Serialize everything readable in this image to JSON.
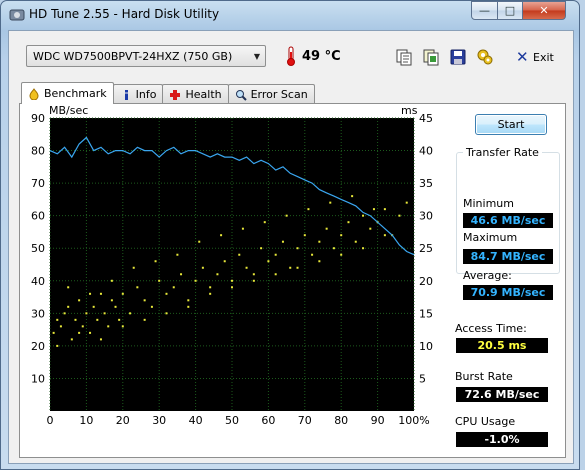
{
  "window": {
    "title": "HD Tune 2.55 - Hard Disk Utility",
    "min_glyph": "—",
    "max_glyph": "□",
    "close_glyph": "✕"
  },
  "toolbar": {
    "drive": "WDC WD7500BPVT-24HXZ (750 GB)",
    "temperature": "49 °C",
    "exit_label": "Exit",
    "icons": [
      "copy-text-icon",
      "copy-info-icon",
      "save-icon",
      "options-icon",
      "exit-icon"
    ]
  },
  "tabs": [
    {
      "label": "Benchmark",
      "icon": "benchmark-icon",
      "active": true
    },
    {
      "label": "Info",
      "icon": "info-icon",
      "active": false
    },
    {
      "label": "Health",
      "icon": "health-icon",
      "active": false
    },
    {
      "label": "Error Scan",
      "icon": "error-scan-icon",
      "active": false
    }
  ],
  "benchmark": {
    "start_label": "Start",
    "transfer_rate_title": "Transfer Rate",
    "minimum_label": "Minimum",
    "minimum_value": "46.6 MB/sec",
    "maximum_label": "Maximum",
    "maximum_value": "84.7 MB/sec",
    "average_label": "Average:",
    "average_value": "70.9 MB/sec",
    "access_time_label": "Access Time:",
    "access_time_value": "20.5 ms",
    "burst_rate_label": "Burst Rate",
    "burst_rate_value": "72.6 MB/sec",
    "cpu_usage_label": "CPU Usage",
    "cpu_usage_value": "-1.0%"
  },
  "colors": {
    "transfer_line": "#3aa6f0",
    "access_dots": "#e8e83a",
    "grid": "#1c5a1c",
    "plot_bg": "#000000"
  },
  "chart_data": {
    "type": "line",
    "ylabel": "MB/sec",
    "y2label": "ms",
    "ylim": [
      0,
      90
    ],
    "y2lim": [
      0,
      45
    ],
    "xlim": [
      0,
      100
    ],
    "x_ticks": [
      "0",
      "10",
      "20",
      "30",
      "40",
      "50",
      "60",
      "70",
      "80",
      "90",
      "100%"
    ],
    "y_ticks": [
      "10",
      "20",
      "30",
      "40",
      "50",
      "60",
      "70",
      "80",
      "90"
    ],
    "y2_ticks": [
      "5",
      "10",
      "15",
      "20",
      "25",
      "30",
      "35",
      "40",
      "45"
    ],
    "grid": true,
    "series": [
      {
        "type": "line",
        "axis": "left",
        "x": [
          0,
          2,
          4,
          6,
          8,
          10,
          12,
          14,
          16,
          18,
          20,
          22,
          24,
          26,
          28,
          30,
          32,
          34,
          36,
          38,
          40,
          42,
          44,
          46,
          48,
          50,
          52,
          54,
          56,
          58,
          60,
          62,
          64,
          66,
          68,
          70,
          72,
          74,
          76,
          78,
          80,
          82,
          84,
          86,
          88,
          90,
          92,
          94,
          96,
          98,
          100
        ],
        "values": [
          80,
          79,
          81,
          78,
          82,
          84,
          80,
          81,
          79,
          80,
          80,
          79,
          81,
          80,
          80,
          78,
          80,
          81,
          79,
          80,
          80,
          79,
          78,
          79,
          78,
          78,
          77,
          78,
          76,
          77,
          76,
          74,
          75,
          73,
          72,
          71,
          70,
          68,
          67,
          66,
          65,
          64,
          63,
          61,
          60,
          58,
          56,
          54,
          51,
          49,
          48
        ]
      },
      {
        "type": "scatter",
        "axis": "right",
        "x": [
          1,
          2,
          3,
          4,
          5,
          6,
          7,
          8,
          9,
          10,
          11,
          12,
          13,
          14,
          15,
          16,
          17,
          18,
          19,
          20,
          22,
          24,
          26,
          28,
          30,
          32,
          34,
          36,
          38,
          40,
          42,
          44,
          46,
          48,
          50,
          52,
          54,
          56,
          58,
          60,
          62,
          64,
          66,
          68,
          70,
          72,
          74,
          76,
          78,
          80,
          82,
          84,
          86,
          88,
          90,
          92,
          94,
          96,
          98,
          2,
          5,
          8,
          11,
          14,
          17,
          20,
          23,
          26,
          29,
          32,
          35,
          38,
          41,
          44,
          47,
          50,
          53,
          56,
          59,
          62,
          65,
          68,
          71,
          74,
          77,
          80,
          83,
          86,
          89,
          92
        ],
        "values": [
          12,
          14,
          13,
          15,
          16,
          11,
          14,
          17,
          13,
          15,
          12,
          16,
          14,
          18,
          15,
          13,
          17,
          16,
          14,
          18,
          15,
          19,
          17,
          16,
          20,
          18,
          19,
          21,
          17,
          20,
          22,
          19,
          21,
          23,
          20,
          24,
          22,
          21,
          25,
          23,
          24,
          26,
          22,
          25,
          27,
          24,
          26,
          28,
          25,
          27,
          29,
          26,
          30,
          28,
          29,
          31,
          27,
          30,
          32,
          10,
          19,
          12,
          18,
          11,
          20,
          13,
          22,
          14,
          23,
          15,
          24,
          16,
          26,
          18,
          27,
          19,
          28,
          20,
          29,
          21,
          30,
          22,
          31,
          23,
          32,
          24,
          33,
          25,
          31,
          27
        ]
      }
    ]
  }
}
